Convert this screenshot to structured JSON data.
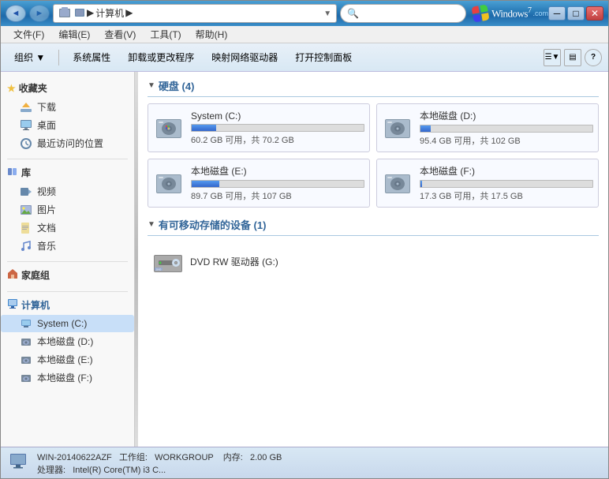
{
  "window": {
    "title": "计算机",
    "controls": {
      "minimize": "─",
      "maximize": "□",
      "close": "✕"
    }
  },
  "titlebar": {
    "back_btn": "◄",
    "forward_btn": "►",
    "address": {
      "icon": "🖥",
      "path": "▶ 计算机 ▶",
      "dropdown": "▼"
    },
    "search_placeholder": "搜索"
  },
  "menu": {
    "items": [
      "文件(F)",
      "编辑(E)",
      "查看(V)",
      "工具(T)",
      "帮助(H)"
    ]
  },
  "toolbar": {
    "buttons": [
      "组织 ▼",
      "系统属性",
      "卸载或更改程序",
      "映射网络驱动器",
      "打开控制面板"
    ],
    "help_icon": "?",
    "view_icon": "☰"
  },
  "sidebar": {
    "sections": [
      {
        "name": "favorites",
        "header": "收藏夹",
        "icon": "★",
        "items": [
          {
            "name": "downloads",
            "label": "下载",
            "icon": "📥"
          },
          {
            "name": "desktop",
            "label": "桌面",
            "icon": "🖥"
          },
          {
            "name": "recent",
            "label": "最近访问的位置",
            "icon": "🕐"
          }
        ]
      },
      {
        "name": "library",
        "header": "库",
        "icon": "📚",
        "items": [
          {
            "name": "video",
            "label": "视频",
            "icon": "🎬"
          },
          {
            "name": "pictures",
            "label": "图片",
            "icon": "🖼"
          },
          {
            "name": "documents",
            "label": "文档",
            "icon": "📄"
          },
          {
            "name": "music",
            "label": "音乐",
            "icon": "🎵"
          }
        ]
      },
      {
        "name": "homegroup",
        "header": "家庭组",
        "icon": "🏠",
        "items": []
      },
      {
        "name": "computer",
        "header": "计算机",
        "icon": "💻",
        "items": [
          {
            "name": "drive-c",
            "label": "System (C:)",
            "icon": "💾"
          },
          {
            "name": "drive-d",
            "label": "本地磁盘 (D:)",
            "icon": "💾"
          },
          {
            "name": "drive-e",
            "label": "本地磁盘 (E:)",
            "icon": "💾"
          },
          {
            "name": "drive-f",
            "label": "本地磁盘 (F:)",
            "icon": "💾"
          }
        ]
      }
    ]
  },
  "content": {
    "harddisk_section": {
      "title": "硬盘 (4)",
      "drives": [
        {
          "name": "system-c",
          "label": "System (C:)",
          "free": "60.2 GB 可用，共 70.2 GB",
          "free_gb": 60.2,
          "total_gb": 70.2,
          "used_pct": 14,
          "bar_color": "blue"
        },
        {
          "name": "local-d",
          "label": "本地磁盘 (D:)",
          "free": "95.4 GB 可用，共 102 GB",
          "free_gb": 95.4,
          "total_gb": 102,
          "used_pct": 6,
          "bar_color": "blue"
        },
        {
          "name": "local-e",
          "label": "本地磁盘 (E:)",
          "free": "89.7 GB 可用，共 107 GB",
          "free_gb": 89.7,
          "total_gb": 107,
          "used_pct": 16,
          "bar_color": "blue"
        },
        {
          "name": "local-f",
          "label": "本地磁盘 (F:)",
          "free": "17.3 GB 可用，共 17.5 GB",
          "free_gb": 17.3,
          "total_gb": 17.5,
          "used_pct": 1,
          "bar_color": "blue"
        }
      ]
    },
    "removable_section": {
      "title": "有可移动存储的设备 (1)",
      "devices": [
        {
          "name": "dvd-g",
          "label": "DVD RW 驱动器 (G:)"
        }
      ]
    }
  },
  "statusbar": {
    "computer_name": "WIN-20140622AZF",
    "workgroup_label": "工作组:",
    "workgroup": "WORKGROUP",
    "memory_label": "内存:",
    "memory": "2.00 GB",
    "processor_label": "处理器:",
    "processor": "Intel(R) Core(TM) i3 C..."
  },
  "colors": {
    "accent": "#2a7cb8",
    "sidebar_selected": "#c8dff8",
    "drive_bar_blue": "#3366cc",
    "section_header": "#336699"
  }
}
